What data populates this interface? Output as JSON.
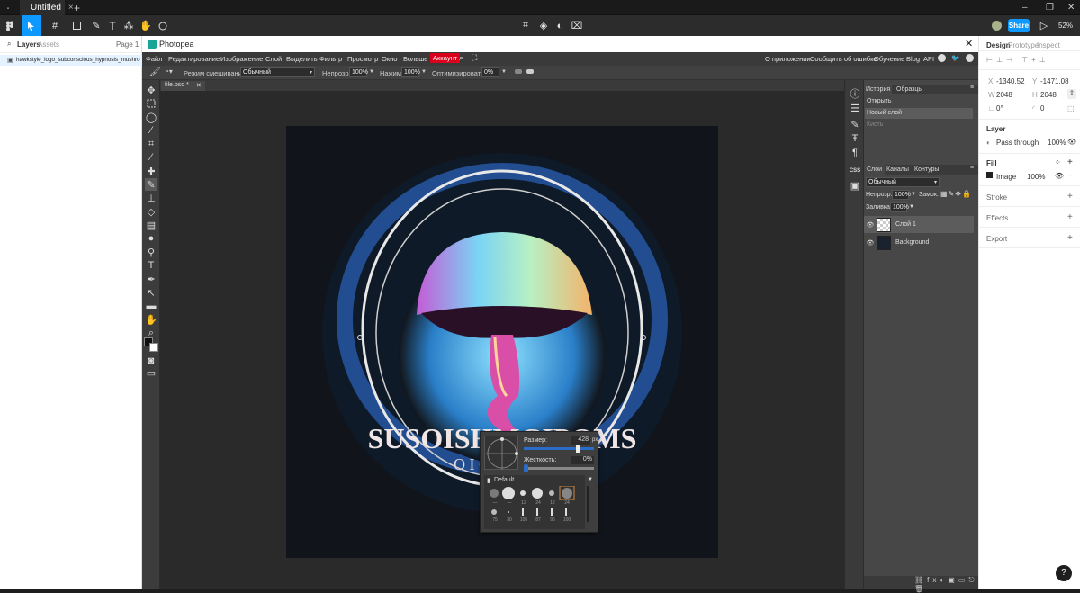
{
  "os": {
    "tab_title": "Untitled"
  },
  "figma": {
    "share_label": "Share",
    "zoom": "52%",
    "left_tabs": [
      "Layers",
      "Assets"
    ],
    "page": "Page 1",
    "layer_name": "hawkstyle_logo_subconscious_hypnosis_mushrooms...",
    "right_tabs": [
      "Design",
      "Prototype",
      "Inspect"
    ],
    "x": "-1340.52",
    "y": "-1471.08",
    "w": "2048",
    "h": "2048",
    "rotation": "0°",
    "radius": "0",
    "layer_section": "Layer",
    "blend": "Pass through",
    "layer_opacity": "100%",
    "fill_section": "Fill",
    "fill_type": "Image",
    "fill_opacity": "100%",
    "stroke": "Stroke",
    "effects": "Effects",
    "export": "Export",
    "help": "?"
  },
  "photopea": {
    "title": "Photopea",
    "menu": [
      "Файл",
      "Редактирование",
      "Изображение",
      "Слой",
      "Выделить",
      "Фильтр",
      "Просмотр",
      "Окно",
      "Больше"
    ],
    "account": "Аккаунт",
    "right_links": [
      "О приложении",
      "Сообщить об ошибке",
      "Обучение",
      "Blog",
      "API"
    ],
    "opts": {
      "blend_label": "Режим смешивания:",
      "blend_value": "Обычный",
      "opacity_label": "Непрозр.:",
      "opacity_value": "100%",
      "pressure_label": "Нажим:",
      "pressure_value": "100%",
      "optimize_label": "Оптимизировать:",
      "optimize_value": "0%"
    },
    "doc_tab": "file.psd *",
    "artwork_text": "SUSOISHMGIPOMS",
    "artwork_subtext": "O I C O C O A",
    "brush": {
      "size_label": "Размер:",
      "size_value": "428",
      "size_unit": "px",
      "hardness_label": "Жесткость:",
      "hardness_value": "0%",
      "preset_group": "Default",
      "presets_row1": [
        "—",
        "—",
        "12",
        "24",
        "12",
        "24"
      ],
      "presets_row2": [
        "75",
        "30",
        "105",
        "87",
        "96",
        "100"
      ]
    },
    "history_tabs": [
      "История",
      "Образцы"
    ],
    "history_items": [
      "Открыть",
      "Новый слой",
      "Кисть"
    ],
    "layers_tabs": [
      "Слои",
      "Каналы",
      "Контуры"
    ],
    "layer_blend": "Обычный",
    "layer_opacity_label": "Непрозр.:",
    "layer_opacity": "100%",
    "lock_label": "Замок:",
    "fill_label": "Заливка:",
    "fill_value": "100%",
    "layers": [
      "Слой 1",
      "Background"
    ],
    "side_css": "CSS"
  },
  "colors": {
    "accent": "#0d99ff",
    "account": "#d9001b",
    "pp_bg": "#474747"
  }
}
